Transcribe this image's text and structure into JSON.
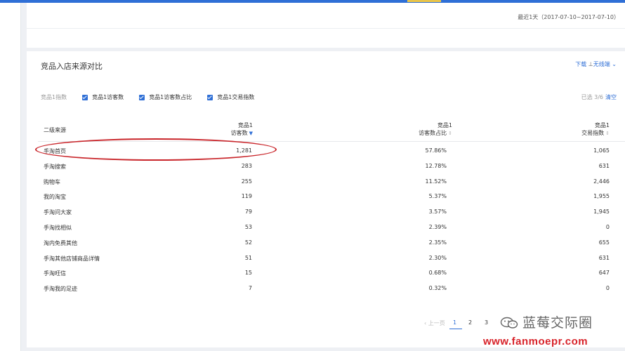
{
  "date_range": "最近1天（2017-07-10~2017-07-10）",
  "section": {
    "title": "竞品入店来源对比",
    "download_label": "下载",
    "terminal_label": "无线端"
  },
  "filters": {
    "label": "竞品1指数",
    "options": [
      {
        "label": "竞品1访客数",
        "checked": true
      },
      {
        "label": "竞品1访客数占比",
        "checked": true
      },
      {
        "label": "竞品1交易指数",
        "checked": true
      }
    ],
    "selected_count": "已选 3/6",
    "clear_label": "清空"
  },
  "table": {
    "headers": {
      "source": "二级来源",
      "visitors_line1": "竞品1",
      "visitors_line2": "访客数",
      "ratio_line1": "竞品1",
      "ratio_line2": "访客数占比",
      "trade_line1": "竞品1",
      "trade_line2": "交易指数"
    },
    "rows": [
      {
        "source": "手淘首页",
        "visitors": "1,281",
        "ratio": "57.86%",
        "trade": "1,065"
      },
      {
        "source": "手淘搜索",
        "visitors": "283",
        "ratio": "12.78%",
        "trade": "631"
      },
      {
        "source": "购物车",
        "visitors": "255",
        "ratio": "11.52%",
        "trade": "2,446"
      },
      {
        "source": "我的淘宝",
        "visitors": "119",
        "ratio": "5.37%",
        "trade": "1,955"
      },
      {
        "source": "手淘问大家",
        "visitors": "79",
        "ratio": "3.57%",
        "trade": "1,945"
      },
      {
        "source": "手淘找相似",
        "visitors": "53",
        "ratio": "2.39%",
        "trade": "0"
      },
      {
        "source": "淘内免费其他",
        "visitors": "52",
        "ratio": "2.35%",
        "trade": "655"
      },
      {
        "source": "手淘其他店铺商品详情",
        "visitors": "51",
        "ratio": "2.30%",
        "trade": "631"
      },
      {
        "source": "手淘旺信",
        "visitors": "15",
        "ratio": "0.68%",
        "trade": "647"
      },
      {
        "source": "手淘我的足迹",
        "visitors": "7",
        "ratio": "0.32%",
        "trade": "0"
      }
    ]
  },
  "pagination": {
    "prev_label": "上一页",
    "pages": [
      "1",
      "2",
      "3"
    ],
    "current": "1"
  },
  "watermark": {
    "text": "蓝莓交际圈",
    "site": "www.fanmoepr.com"
  },
  "colors": {
    "accent": "#2f6fd6",
    "highlight": "#c9262b",
    "watermark_red": "#d8232a"
  }
}
